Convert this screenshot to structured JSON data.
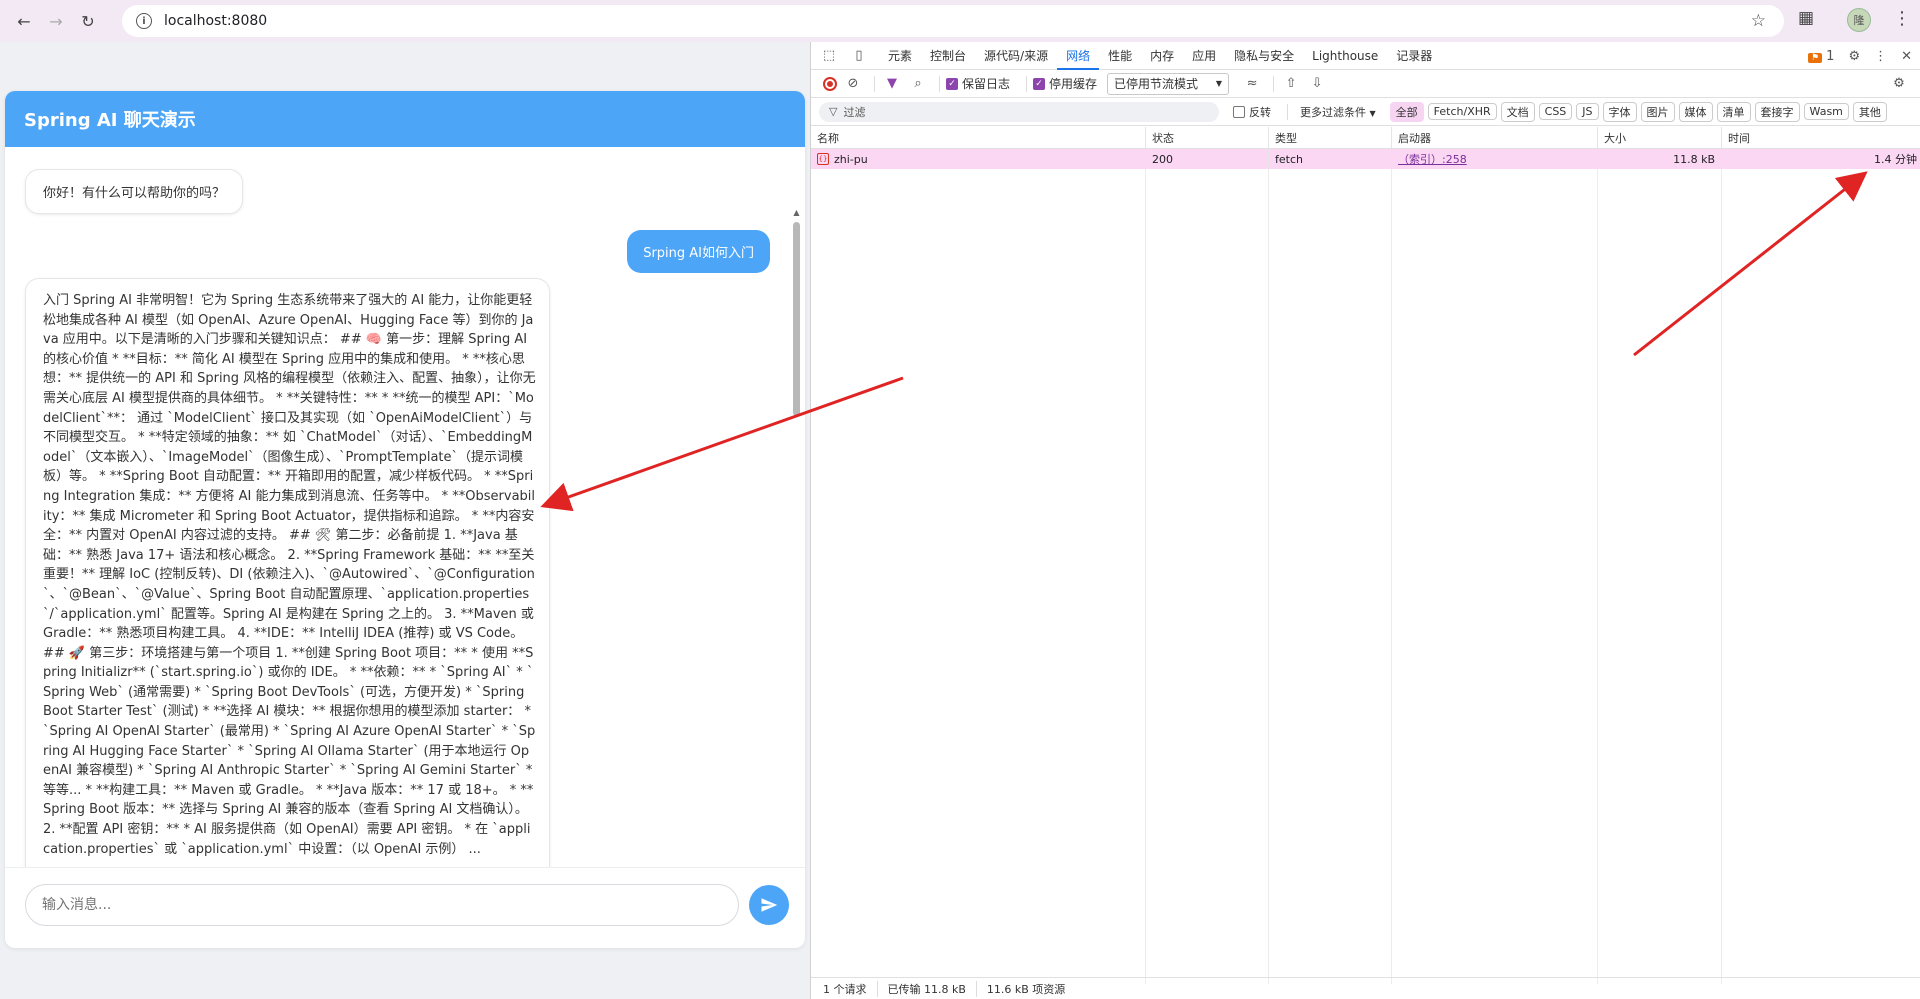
{
  "browser": {
    "url": "localhost:8080",
    "profile_initial": "隆"
  },
  "chat": {
    "title": "Spring AI 聊天演示",
    "greeting": "你好！有什么可以帮助你的吗？",
    "user_message": "Srping AI如何入门",
    "reply": "入门 Spring AI 非常明智！它为 Spring 生态系统带来了强大的 AI 能力，让你能更轻松地集成各种 AI 模型（如 OpenAI、Azure OpenAI、Hugging Face 等）到你的 Java 应用中。以下是清晰的入门步骤和关键知识点： ## 🧠 第一步：理解 Spring AI 的核心价值 * **目标：** 简化 AI 模型在 Spring 应用中的集成和使用。 * **核心思想：** 提供统一的 API 和 Spring 风格的编程模型（依赖注入、配置、抽象），让你无需关心底层 AI 模型提供商的具体细节。 * **关键特性：** * **统一的模型 API：`ModelClient`**： 通过 `ModelClient` 接口及其实现（如 `OpenAiModelClient`）与不同模型交互。 * **特定领域的抽象：** 如 `ChatModel`（对话）、`EmbeddingModel`（文本嵌入）、`ImageModel`（图像生成）、`PromptTemplate`（提示词模板）等。 * **Spring Boot 自动配置：** 开箱即用的配置，减少样板代码。 * **Spring Integration 集成：** 方便将 AI 能力集成到消息流、任务等中。 * **Observability：** 集成 Micrometer 和 Spring Boot Actuator，提供指标和追踪。 * **内容安全：** 内置对 OpenAI 内容过滤的支持。 ## 🛠 第二步：必备前提 1. **Java 基础：** 熟悉 Java 17+ 语法和核心概念。 2. **Spring Framework 基础：** **至关重要！** 理解 IoC (控制反转)、DI (依赖注入)、`@Autowired`、`@Configuration`、`@Bean`、`@Value`、Spring Boot 自动配置原理、`application.properties`/`application.yml` 配置等。Spring AI 是构建在 Spring 之上的。 3. **Maven 或 Gradle：** 熟悉项目构建工具。 4. **IDE：** IntelliJ IDEA (推荐) 或 VS Code。 ## 🚀 第三步：环境搭建与第一个项目 1. **创建 Spring Boot 项目：** * 使用 **Spring Initializr** (`start.spring.io`) 或你的 IDE。 * **依赖：** * `Spring AI` * `Spring Web` (通常需要) * `Spring Boot DevTools` (可选，方便开发) * `Spring Boot Starter Test` (测试) * **选择 AI 模块：** 根据你想用的模型添加 starter： * `Spring AI OpenAI Starter` (最常用) * `Spring AI Azure OpenAI Starter` * `Spring AI Hugging Face Starter` * `Spring AI Ollama Starter` (用于本地运行 OpenAI 兼容模型) * `Spring AI Anthropic Starter` * `Spring AI Gemini Starter` * 等等... * **构建工具：** Maven 或 Gradle。 * **Java 版本：** 17 或 18+。 * **Spring Boot 版本：** 选择与 Spring AI 兼容的版本（查看 Spring AI 文档确认）。 2. **配置 API 密钥：** * AI 服务提供商（如 OpenAI）需要 API 密钥。 * 在 `application.properties` 或 `application.yml` 中设置：（以 OpenAI 示例） ...",
    "input_placeholder": "输入消息..."
  },
  "devtools": {
    "tabs": [
      "元素",
      "控制台",
      "源代码/来源",
      "网络",
      "性能",
      "内存",
      "应用",
      "隐私与安全",
      "Lighthouse",
      "记录器"
    ],
    "active_tab": "网络",
    "issues_count": "1",
    "toolbar": {
      "preserve_log": "保留日志",
      "disable_cache": "停用缓存",
      "throttle": "已停用节流模式"
    },
    "filter": {
      "placeholder": "过滤",
      "invert": "反转",
      "more_filters": "更多过滤条件",
      "chips": [
        "全部",
        "Fetch/XHR",
        "文档",
        "CSS",
        "JS",
        "字体",
        "图片",
        "媒体",
        "清单",
        "套接字",
        "Wasm",
        "其他"
      ]
    },
    "columns": [
      "名称",
      "状态",
      "类型",
      "启动器",
      "大小",
      "时间"
    ],
    "rows": [
      {
        "name": "zhi-pu",
        "status": "200",
        "type": "fetch",
        "initiator": "（索引）:258",
        "size": "11.8 kB",
        "time": "1.4 分钟"
      }
    ],
    "status_bar": [
      "1 个请求",
      "已传输 11.8 kB",
      "11.6 kB 项资源"
    ]
  },
  "colors": {
    "accent": "#4ca5f7",
    "row_highlight": "#fbd7f3",
    "arrow": "#e02424"
  }
}
